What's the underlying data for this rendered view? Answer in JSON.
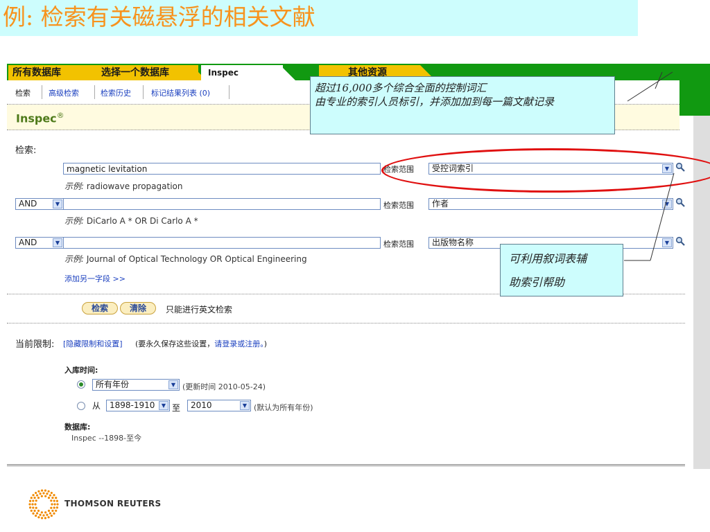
{
  "slide": {
    "title": "例: 检索有关磁悬浮的相关文献",
    "logo_text": "THOMSON REUTERS"
  },
  "tabs": {
    "all_databases": "所有数据库",
    "select_database": "选择一个数据库",
    "inspec": "Inspec",
    "other_resources": "其他资源"
  },
  "subnav": {
    "search": "检索",
    "advanced": "高级检索",
    "history": "检索历史",
    "marked": "标记结果列表",
    "marked_count": "(0)"
  },
  "brand": {
    "name": "Inspec",
    "reg": "®"
  },
  "form": {
    "search_label": "检索:",
    "scope_label": "检索范围",
    "rows": [
      {
        "operator": "",
        "value": "magnetic levitation",
        "example_prefix": "示例:",
        "example": "radiowave propagation",
        "scope": "受控词索引"
      },
      {
        "operator": "AND",
        "value": "",
        "example_prefix": "示例:",
        "example": "DiCarlo A * OR Di Carlo A *",
        "scope": "作者"
      },
      {
        "operator": "AND",
        "value": "",
        "example_prefix": "示例:",
        "example": "Journal of Optical Technology OR Optical Engineering",
        "scope": "出版物名称"
      }
    ],
    "add_field": "添加另一字段 >>",
    "search_button": "检索",
    "clear_button": "清除",
    "english_only": "只能进行英文检索"
  },
  "limits": {
    "label": "当前限制:",
    "hide_link": "[隐藏限制和设置]",
    "save_note": "(要永久保存这些设置，",
    "login_link": "请登录或注册。",
    "save_note_end": ")",
    "timespan_label": "入库时间:",
    "all_years": "所有年份",
    "updated_prefix": "(更新时间 ",
    "updated_date": "2010-05-24",
    "updated_suffix": ")",
    "from_label": "从",
    "from_value": "1898-1910",
    "to_label": "至",
    "to_value": "2010",
    "default_note": "(默认为所有年份)",
    "db_label": "数据库:",
    "db_value": "Inspec --1898-至今"
  },
  "callouts": {
    "top_line1": "超过16,000多个综合全面的控制词汇",
    "top_line2": "由专业的索引人员标引，并添加加到每一篇文献记录",
    "thesaurus_line1": "可利用叙词表辅",
    "thesaurus_line2": "助索引帮助"
  },
  "colors": {
    "title_text": "#f7931e",
    "title_bg": "#cdfdfd",
    "tab_green": "#119911",
    "tab_yellow": "#f2c200",
    "highlight_ellipse": "#e01010"
  }
}
